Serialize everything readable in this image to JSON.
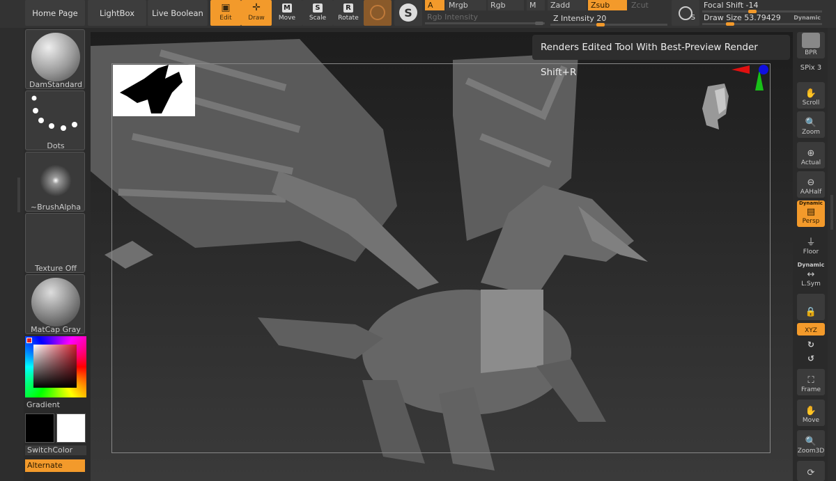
{
  "topbar": {
    "home_page": "Home Page",
    "lightbox": "LightBox",
    "live_boolean": "Live Boolean",
    "edit": "Edit",
    "draw": "Draw",
    "move": "Move",
    "scale": "Scale",
    "rotate": "Rotate",
    "move_letter": "M",
    "scale_letter": "S",
    "rotate_letter": "R",
    "a": "A",
    "mrgb": "Mrgb",
    "rgb": "Rgb",
    "m": "M",
    "zadd": "Zadd",
    "zsub": "Zsub",
    "zcut": "Zcut",
    "rgb_intensity": "Rgb Intensity",
    "z_intensity": "Z Intensity 20",
    "focal_shift": "Focal Shift -14",
    "draw_size": "Draw Size 53.79429",
    "dynamic": "Dynamic",
    "s": "S"
  },
  "left": {
    "brush": "DamStandard",
    "stroke": "Dots",
    "alpha": "~BrushAlpha",
    "texture": "Texture Off",
    "material": "MatCap Gray",
    "gradient": "Gradient",
    "switch_color": "SwitchColor",
    "alternate": "Alternate"
  },
  "tooltip": "Renders Edited Tool With Best-Preview Render  Shift+R",
  "right": {
    "bpr": "BPR",
    "spix": "SPix 3",
    "scroll": "Scroll",
    "zoom": "Zoom",
    "actual": "Actual",
    "aahalf": "AAHalf",
    "dynamic": "Dynamic",
    "persp": "Persp",
    "floor": "Floor",
    "lsym": "L.Sym",
    "xyz": "XYZ",
    "frame": "Frame",
    "move": "Move",
    "zoom3d": "Zoom3D"
  },
  "colors": {
    "accent": "#f39a2b",
    "panel": "#3b3b3b",
    "background": "#2a2a2a"
  }
}
